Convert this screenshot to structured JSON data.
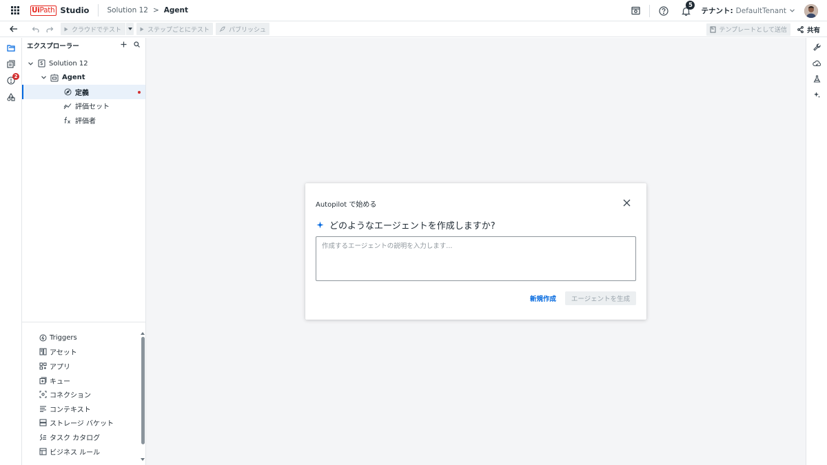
{
  "header": {
    "brand_ui": "Ui",
    "brand_path": "Path",
    "product": "Studio",
    "breadcrumb": [
      "Solution 12",
      "Agent"
    ],
    "breadcrumb_separator": ">",
    "notification_count": "5",
    "tenant_label": "テナント:",
    "tenant_value": "DefaultTenant"
  },
  "toolbar": {
    "test_cloud": "クラウドでテスト",
    "test_step": "ステップごとにテスト",
    "publish": "パブリッシュ",
    "send_template": "テンプレートとして送信",
    "share": "共有"
  },
  "left_rail": {
    "badge_count": "2"
  },
  "explorer": {
    "title": "エクスプローラー",
    "solution": "Solution 12",
    "agent": "Agent",
    "children": [
      "定義",
      "評価セット",
      "評価者"
    ]
  },
  "resources": [
    {
      "label": "Triggers",
      "icon": "triggers-icon"
    },
    {
      "label": "アセット",
      "icon": "asset-icon"
    },
    {
      "label": "アプリ",
      "icon": "app-icon"
    },
    {
      "label": "キュー",
      "icon": "queue-icon"
    },
    {
      "label": "コネクション",
      "icon": "connection-icon"
    },
    {
      "label": "コンテキスト",
      "icon": "context-icon"
    },
    {
      "label": "ストレージ バケット",
      "icon": "storage-bucket-icon"
    },
    {
      "label": "タスク カタログ",
      "icon": "task-catalog-icon"
    },
    {
      "label": "ビジネス ルール",
      "icon": "business-rule-icon"
    }
  ],
  "dialog": {
    "title": "Autopilot で始める",
    "question": "どのようなエージェントを作成しますか?",
    "input_placeholder": "作成するエージェントの説明を入力します...",
    "input_value": "",
    "new_button": "新規作成",
    "generate_button": "エージェントを生成"
  },
  "colors": {
    "brand_red": "#e5261e",
    "accent_blue": "#0067df",
    "canvas_bg": "#f4f5f7",
    "badge_red": "#d32f2f"
  }
}
